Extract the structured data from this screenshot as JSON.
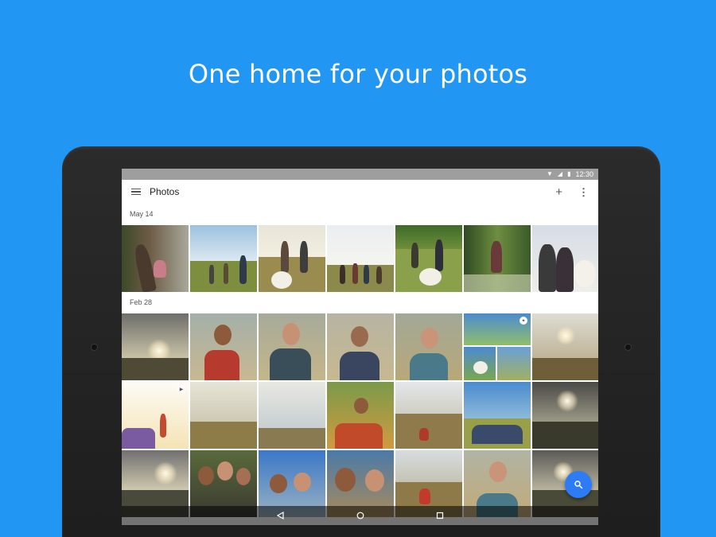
{
  "headline": "One home for your photos",
  "status_bar": {
    "time": "12:30",
    "icons": [
      "wifi-icon",
      "signal-icon",
      "battery-icon"
    ]
  },
  "app_bar": {
    "title": "Photos",
    "actions": [
      "add-icon",
      "more-vert-icon"
    ]
  },
  "sections": [
    {
      "label": "May 14",
      "photo_count": 7
    },
    {
      "label": "Feb 28",
      "photo_count": 21
    }
  ],
  "fab_icon": "search-icon",
  "nav_bar": [
    "back-icon",
    "home-icon",
    "recents-icon"
  ],
  "colors": {
    "background": "#2196f3",
    "fab": "#2d7cf6",
    "status_bar": "#9e9e9e"
  }
}
